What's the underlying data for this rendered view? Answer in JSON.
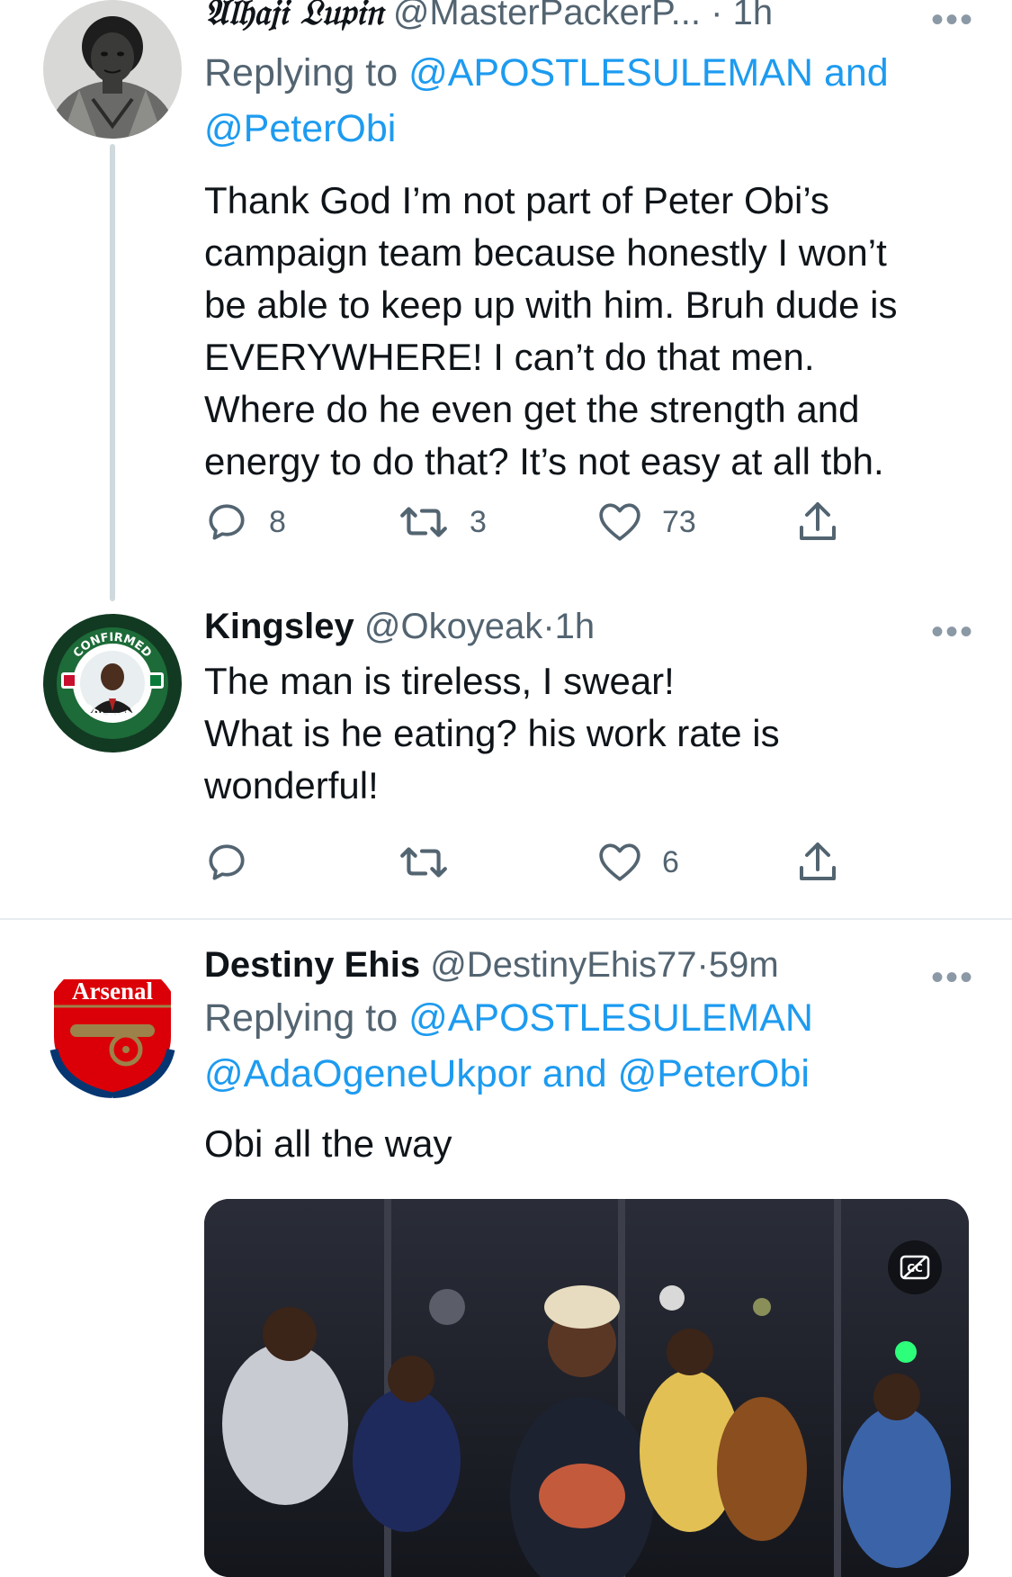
{
  "tweets": [
    {
      "display_name": "𝔄𝔩𝔥𝔞𝔧𝔦 𝔏𝔲𝔭𝔦𝔫",
      "handle": "@MasterPackerP...",
      "sep": "·",
      "time": "1h",
      "replying_prefix": "Replying to",
      "replying_mention_1": "@APOSTLESULEMAN",
      "replying_and": "and",
      "replying_mention_2": "@PeterObi",
      "text": "Thank God I’m not part of Peter Obi’s\ncampaign team because honestly I won’t\nbe able to keep up with him. Bruh dude is\nEVERYWHERE! I can’t do that men.\nWhere do he even get the strength and\nenergy to do that? It’s not easy at all tbh.",
      "replies": "8",
      "retweets": "3",
      "likes": "73",
      "avatar_icon": "portrait-avatar"
    },
    {
      "display_name": "Kingsley",
      "handle": "@Okoyeak",
      "sep": "·",
      "time": "1h",
      "text": "The man is tireless, I swear!\nWhat is he eating? his work rate is\nwonderful!",
      "replies": "",
      "retweets": "",
      "likes": "6",
      "avatar_icon": "obi-dient-badge",
      "avatar_text_top": "CONFIRMED",
      "avatar_text_bottom": "OBI-DIENT"
    },
    {
      "display_name": "Destiny Ehis",
      "handle": "@DestinyEhis77",
      "sep": "·",
      "time": "59m",
      "replying_prefix": "Replying to",
      "replying_mention_1": "@APOSTLESULEMAN",
      "replying_mention_2": "@AdaOgeneUkpor",
      "replying_and": "and",
      "replying_mention_3": "@PeterObi",
      "text": "Obi all the way",
      "avatar_icon": "arsenal-crest",
      "avatar_text": "Arsenal",
      "media_icon": "video-thumbnail",
      "cc_icon": "closed-captions-icon"
    }
  ],
  "more_icon": "more-options-icon",
  "colors": {
    "link": "#1d9bf0",
    "secondary_text": "#536471",
    "primary_text": "#0f1419",
    "divider": "#e6ecf0",
    "thread_line": "#cfd9de"
  }
}
